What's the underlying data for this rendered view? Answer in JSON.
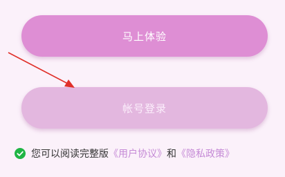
{
  "buttons": {
    "experience_label": "马上体验",
    "account_login_label": "帐号登录"
  },
  "agreement": {
    "prefix": "您可以阅读完整版",
    "user_agreement_link": "《用户协议》",
    "conjunction": "和",
    "privacy_policy_link": "《隐私政策》",
    "checked": true
  },
  "colors": {
    "background": "#fbf1fa",
    "primary_button": "#de8ed4",
    "secondary_button": "#e3b7df",
    "link": "#c58ad6",
    "check": "#1fb545",
    "arrow": "#e0302a"
  },
  "icons": {
    "checkbox": "check-circle-icon",
    "annotation": "red-arrow-icon"
  }
}
